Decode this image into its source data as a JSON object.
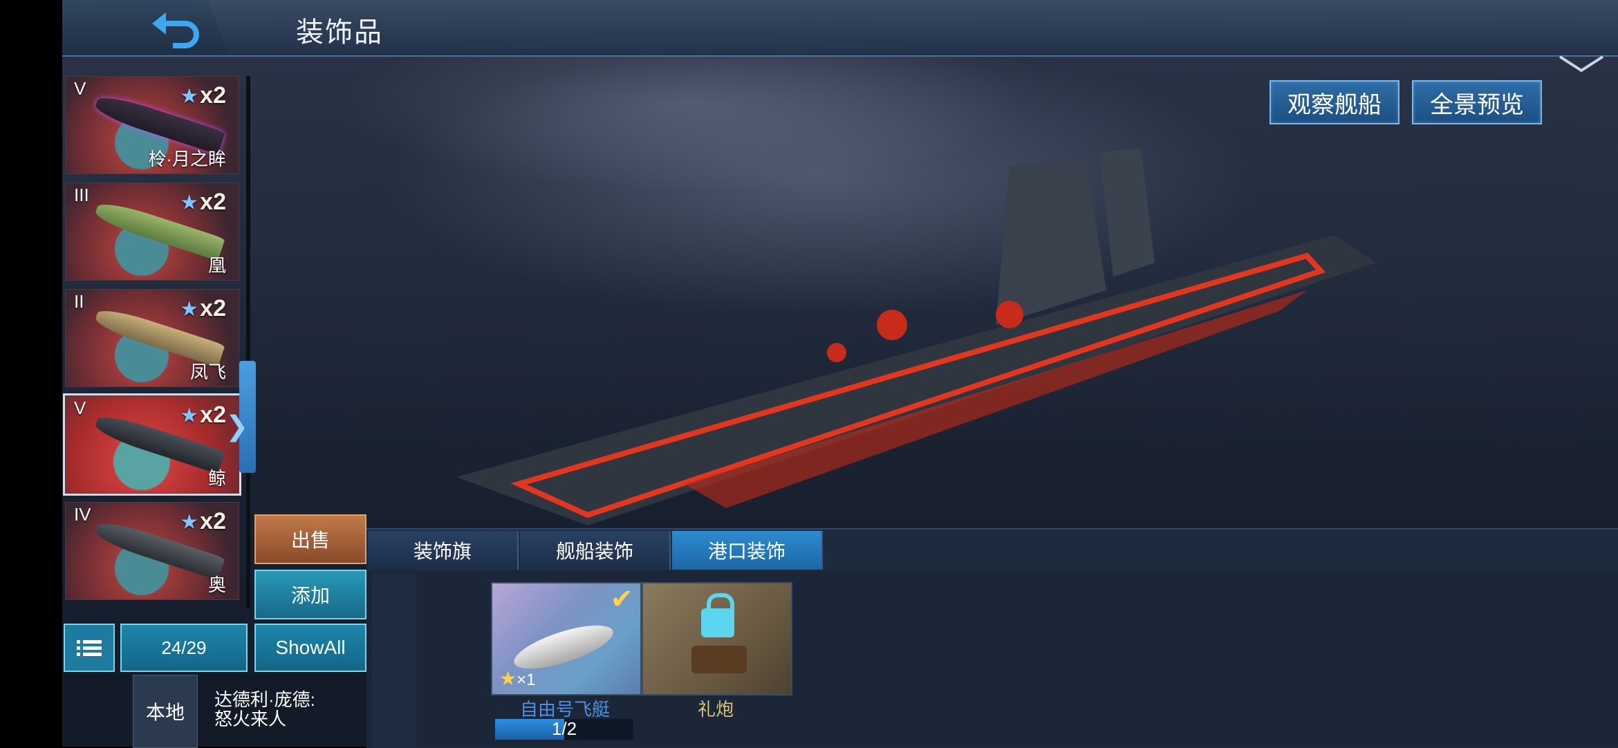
{
  "header": {
    "title": "装饰品",
    "back_icon": "back-arrow-icon"
  },
  "top_buttons": {
    "observe": "观察舰船",
    "panorama": "全景预览"
  },
  "ship_list": [
    {
      "tier": "V",
      "stars": "x2",
      "name": "柃·月之眸"
    },
    {
      "tier": "III",
      "stars": "x2",
      "name": "凰"
    },
    {
      "tier": "II",
      "stars": "x2",
      "name": "凤飞"
    },
    {
      "tier": "V",
      "stars": "x2",
      "name": "鲸",
      "selected": true
    },
    {
      "tier": "IV",
      "stars": "x2",
      "name": "奥"
    }
  ],
  "actions": {
    "sell": "出售",
    "add": "添加",
    "count": "24/29",
    "show_all": "ShowAll"
  },
  "chat": {
    "channel": "本地",
    "message_line1": "达德利·庞德:",
    "message_line2": "怒火来人"
  },
  "tabs": [
    {
      "label": "装饰旗",
      "active": false
    },
    {
      "label": "舰船装饰",
      "active": false
    },
    {
      "label": "港口装饰",
      "active": true
    }
  ],
  "items": [
    {
      "name": "自由号飞艇",
      "quantity": "×1",
      "selected": true,
      "progress_text": "1/2",
      "progress": 0.5
    },
    {
      "name": "礼炮",
      "locked": true
    }
  ],
  "colors": {
    "accent": "#2d8bd0",
    "selected_item_name": "#4f8fe0",
    "locked_item_name": "#d9c27a"
  }
}
